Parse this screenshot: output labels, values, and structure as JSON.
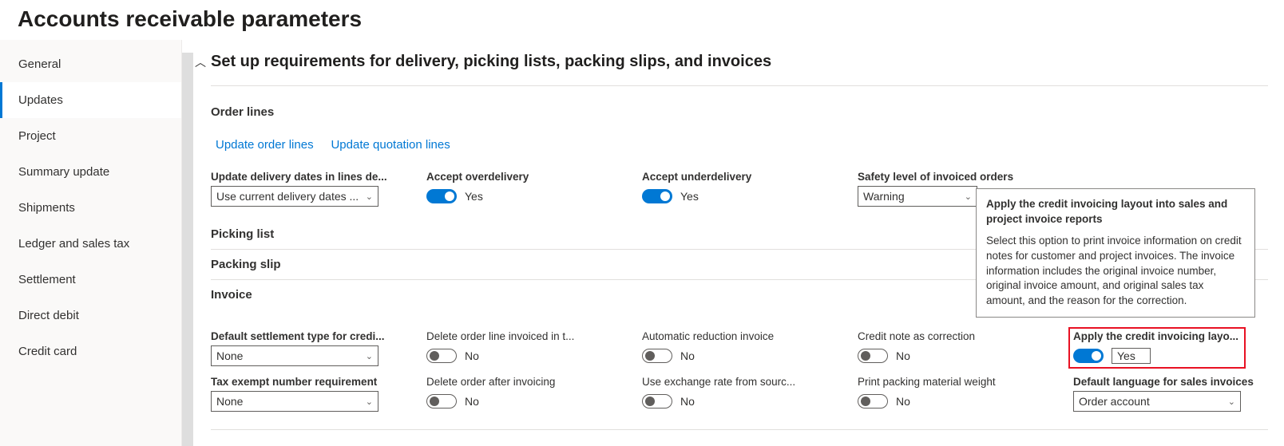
{
  "page": {
    "title": "Accounts receivable parameters"
  },
  "sidebar": {
    "items": [
      {
        "label": "General"
      },
      {
        "label": "Updates"
      },
      {
        "label": "Project"
      },
      {
        "label": "Summary update"
      },
      {
        "label": "Shipments"
      },
      {
        "label": "Ledger and sales tax"
      },
      {
        "label": "Settlement"
      },
      {
        "label": "Direct debit"
      },
      {
        "label": "Credit card"
      }
    ]
  },
  "main": {
    "section_title": "Set up requirements for delivery, picking lists, packing slips, and invoices",
    "groups": {
      "order_lines": {
        "header": "Order lines",
        "links": {
          "update_order": "Update order lines",
          "update_quotation": "Update quotation lines"
        },
        "fields": {
          "update_delivery": {
            "label": "Update delivery dates in lines de...",
            "value": "Use current delivery dates ..."
          },
          "accept_over": {
            "label": "Accept overdelivery",
            "value": "Yes"
          },
          "accept_under": {
            "label": "Accept underdelivery",
            "value": "Yes"
          },
          "safety_level": {
            "label": "Safety level of invoiced orders",
            "value": "Warning"
          }
        }
      },
      "picking_list": {
        "header": "Picking list"
      },
      "packing_slip": {
        "header": "Packing slip"
      },
      "invoice": {
        "header": "Invoice",
        "row1": {
          "default_settlement": {
            "label": "Default settlement type for credi...",
            "value": "None"
          },
          "delete_invoiced": {
            "label": "Delete order line invoiced in t...",
            "value": "No"
          },
          "auto_reduction": {
            "label": "Automatic reduction invoice",
            "value": "No"
          },
          "credit_correction": {
            "label": "Credit note as correction",
            "value": "No"
          },
          "apply_credit_layout": {
            "label": "Apply the credit invoicing layo...",
            "value": "Yes"
          }
        },
        "row2": {
          "tax_exempt": {
            "label": "Tax exempt number requirement",
            "value": "None"
          },
          "delete_after": {
            "label": "Delete order after invoicing",
            "value": "No"
          },
          "use_exchange": {
            "label": "Use exchange rate from sourc...",
            "value": "No"
          },
          "print_packing": {
            "label": "Print packing material weight",
            "value": "No"
          },
          "default_lang": {
            "label": "Default language for sales invoices",
            "value": "Order account"
          }
        }
      }
    }
  },
  "tooltip": {
    "title": "Apply the credit invoicing layout into sales and project invoice reports",
    "body": "Select this option to print invoice information on credit notes for customer and project invoices. The invoice information includes the original invoice number, original invoice amount, and original sales tax amount, and the reason for the correction."
  }
}
